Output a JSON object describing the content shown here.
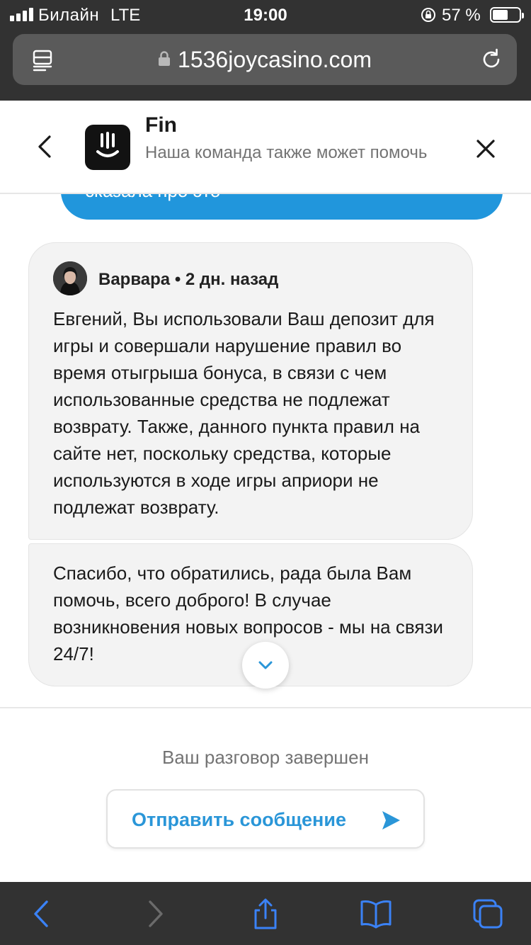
{
  "status_bar": {
    "carrier": "Билайн",
    "network": "LTE",
    "time": "19:00",
    "battery_percent": "57 %",
    "battery_level": 0.57
  },
  "browser": {
    "url": "1536joycasino.com",
    "icons": {
      "reader": "reader-icon",
      "lock": "lock-icon",
      "reload": "reload-icon"
    }
  },
  "header": {
    "bot_name": "Fin",
    "subtitle": "Наша команда также может помочь",
    "icons": {
      "back": "chevron-left-icon",
      "close": "close-icon",
      "avatar": "fin-logo"
    }
  },
  "conversation": {
    "previous_user_message_fragment": "сказала про это",
    "agent": {
      "name": "Варвара",
      "time_ago": "2 дн. назад",
      "separator": "•"
    },
    "messages": [
      "Евгений, Вы использовали Ваш депозит для игры и совершали нарушение правил во время отыгрыша бонуса, в связи с чем использованные средства не подлежат возврату. Также, данного пункта правил на сайте нет, поскольку средства, которые используются в ходе игры априори не подлежат возврату.",
      "Спасибо, что обратились, рада была Вам помочь, всего доброго! В случае возникновения новых вопросов - мы на связи 24/7!"
    ]
  },
  "footer": {
    "conversation_ended": "Ваш разговор завершен",
    "send_button_label": "Отправить сообщение"
  },
  "colors": {
    "accent": "#2a96d8",
    "user_bubble": "#2196dc",
    "agent_bubble": "#f3f3f3",
    "browser_chrome": "#323232",
    "toolbar_active": "#3b82f6"
  }
}
